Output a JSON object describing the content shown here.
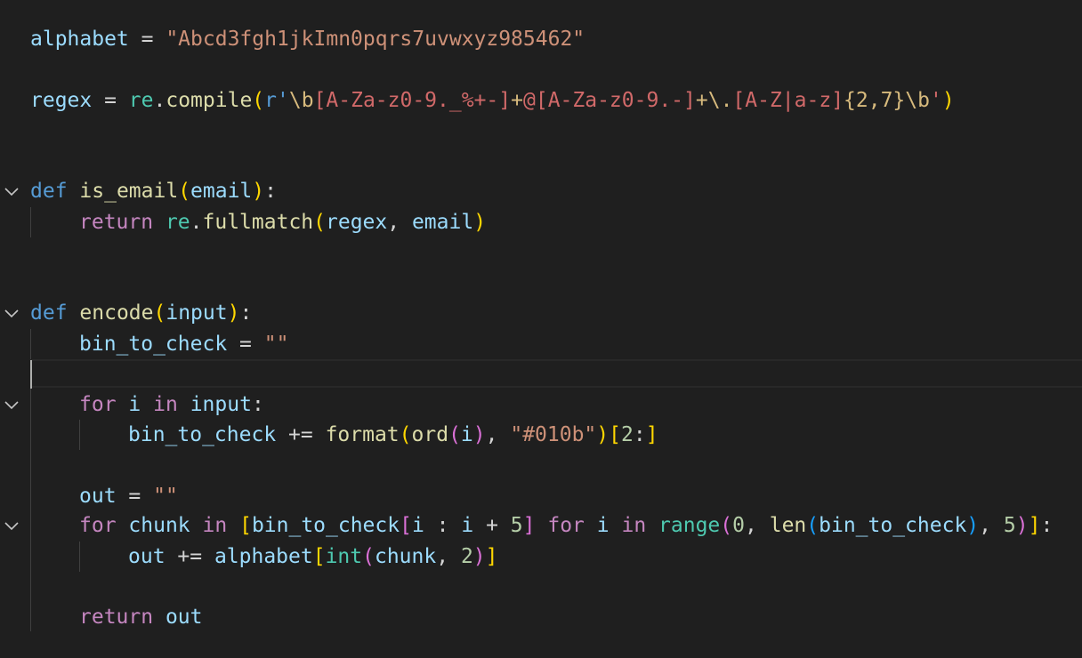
{
  "theme": {
    "background": "#1f1f1f",
    "keyword": "#569cd6",
    "control": "#c586c0",
    "function": "#dcdcaa",
    "variable": "#9cdcfe",
    "string": "#ce9178",
    "regex": "#d16969"
  },
  "code": {
    "l1": {
      "alphabet": "alphabet",
      "eq": " = ",
      "str": "\"Abcd3fgh1jkImn0pqrs7uvwxyz985462\""
    },
    "l2": {
      "regex": "regex",
      "eq": " = ",
      "re": "re",
      "dot": ".",
      "compile": "compile",
      "paren_open": "(",
      "r": "r'",
      "esc1": "\\b",
      "cls1": "[A-Za-z0-9._%+-]",
      "plus1": "+",
      "at": "@",
      "cls2": "[A-Za-z0-9.-]",
      "plus2": "+",
      "esc2": "\\.",
      "cls3": "[A-Z|a-z]",
      "quant": "{2,7}",
      "esc3": "\\b",
      "quote": "'",
      "paren_close": ")"
    },
    "l3": {
      "def": "def",
      "sp": " ",
      "name": "is_email",
      "po": "(",
      "arg": "email",
      "pc": ")",
      "colon": ":"
    },
    "l4": {
      "ret": "return",
      "sp": " ",
      "re": "re",
      "dot": ".",
      "fn": "fullmatch",
      "po": "(",
      "a1": "regex",
      "comma": ", ",
      "a2": "email",
      "pc": ")"
    },
    "l5": {
      "def": "def",
      "sp": " ",
      "name": "encode",
      "po": "(",
      "arg": "input",
      "pc": ")",
      "colon": ":"
    },
    "l6": {
      "var": "bin_to_check",
      "eq": " = ",
      "str": "\"\""
    },
    "l7": {
      "for": "for",
      "i": "i",
      "in": "in",
      "input": "input",
      "colon": ":"
    },
    "l8": {
      "var": "bin_to_check",
      "op": " += ",
      "fmt": "format",
      "p1": "(",
      "ord": "ord",
      "p2": "(",
      "i": "i",
      "p2c": ")",
      "comma": ", ",
      "str": "\"#010b\"",
      "p1c": ")",
      "b_open": "[",
      "num": "2",
      "colon": ":",
      "b_close": "]"
    },
    "l9": {
      "var": "out",
      "eq": " = ",
      "str": "\"\""
    },
    "l10": {
      "for": "for",
      "chunk": "chunk",
      "in": "in",
      "b_open": "[",
      "btc": "bin_to_check",
      "b2_open": "[",
      "i1": "i",
      "sep": " : ",
      "i2": "i",
      "plus": " + ",
      "five": "5",
      "b2_close": "]",
      "for2": "for",
      "i3": "i",
      "in2": "in",
      "range": "range",
      "p_open": "(",
      "zero": "0",
      "comma1": ", ",
      "len": "len",
      "p2_open": "(",
      "btc2": "bin_to_check",
      "p2_close": ")",
      "comma2": ", ",
      "five2": "5",
      "p_close": ")",
      "b_close": "]",
      "colon": ":"
    },
    "l11": {
      "var": "out",
      "op": " += ",
      "alphabet": "alphabet",
      "b_open": "[",
      "int": "int",
      "p_open": "(",
      "chunk": "chunk",
      "comma": ", ",
      "two": "2",
      "p_close": ")",
      "b_close": "]"
    },
    "l12": {
      "ret": "return",
      "out": "out"
    }
  },
  "gutter": {
    "fold_icon": "chevron-down-icon"
  }
}
